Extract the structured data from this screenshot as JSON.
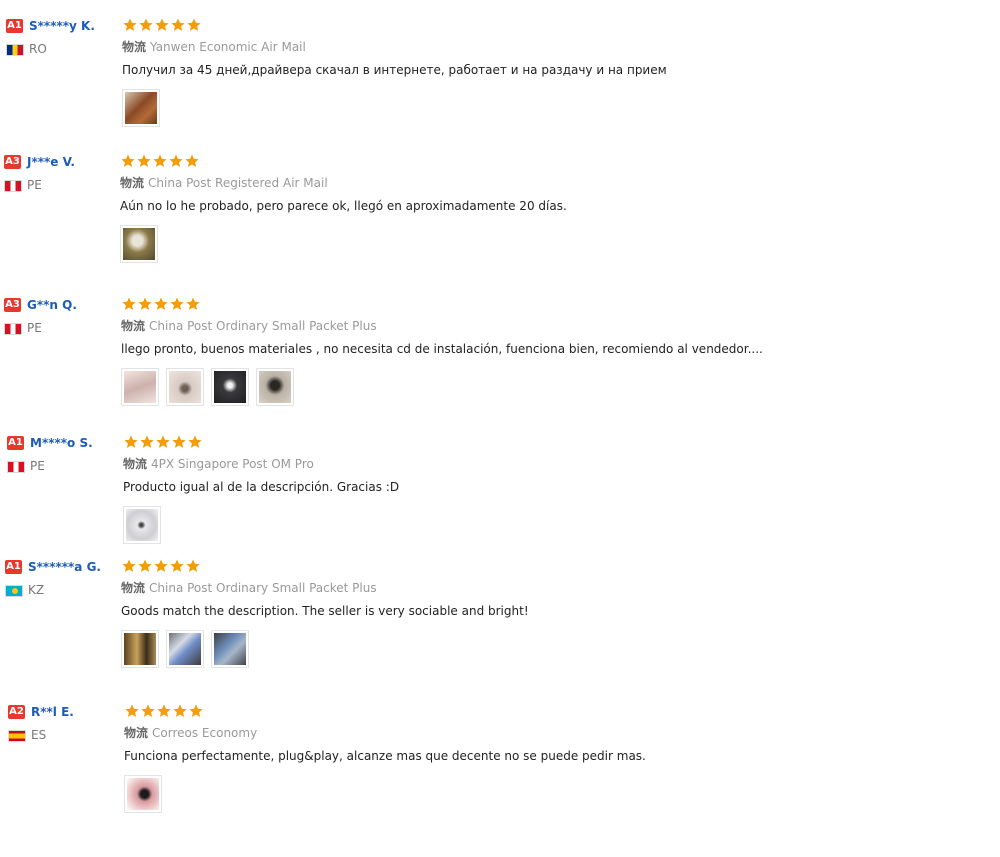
{
  "logistics_label": "物流",
  "colors": {
    "star": "#f29d0c",
    "badge": "#e8372d",
    "username": "#1c5cb8"
  },
  "reviews": [
    {
      "level": "A1",
      "user": "S*****y K.",
      "country": "RO",
      "stars": 5,
      "logistics": "Yanwen Economic Air Mail",
      "comment": "Получил за 45 дней,драйвера скачал в интернете, работает и на раздачу и на прием",
      "photos": [
        "brown-device"
      ]
    },
    {
      "level": "A3",
      "user": "J***e V.",
      "country": "PE",
      "stars": 5,
      "logistics": "China Post Registered Air Mail",
      "comment": "Aún no lo he probado, pero parece ok, llegó en aproximadamente 20 días.",
      "photos": [
        "olive-package"
      ]
    },
    {
      "level": "A3",
      "user": "G**n Q.",
      "country": "PE",
      "stars": 5,
      "logistics": "China Post Ordinary Small Packet Plus",
      "comment": "llego pronto, buenos materiales , no necesita cd de instalación, fuenciona bien, recomiendo al vendedor....",
      "photos": [
        "pink-packet",
        "beige-device",
        "dark-device",
        "grey-device"
      ]
    },
    {
      "level": "A1",
      "user": "M****o S.",
      "country": "PE",
      "stars": 5,
      "logistics": "4PX Singapore Post OM Pro",
      "comment": "Producto igual al de la descripción. Gracias :D",
      "photos": [
        "white-device"
      ]
    },
    {
      "level": "A1",
      "user": "S******a G.",
      "country": "KZ",
      "stars": 5,
      "logistics": "China Post Ordinary Small Packet Plus",
      "comment": "Goods match the description. The seller is very sociable and bright!",
      "photos": [
        "dark-box",
        "blue-box",
        "blue-device"
      ]
    },
    {
      "level": "A2",
      "user": "R**l E.",
      "country": "ES",
      "stars": 5,
      "logistics": "Correos Economy",
      "comment": "Funciona perfectamente, plug&play, alcanze mas que decente no se puede pedir mas.",
      "photos": [
        "hand-device"
      ]
    }
  ]
}
